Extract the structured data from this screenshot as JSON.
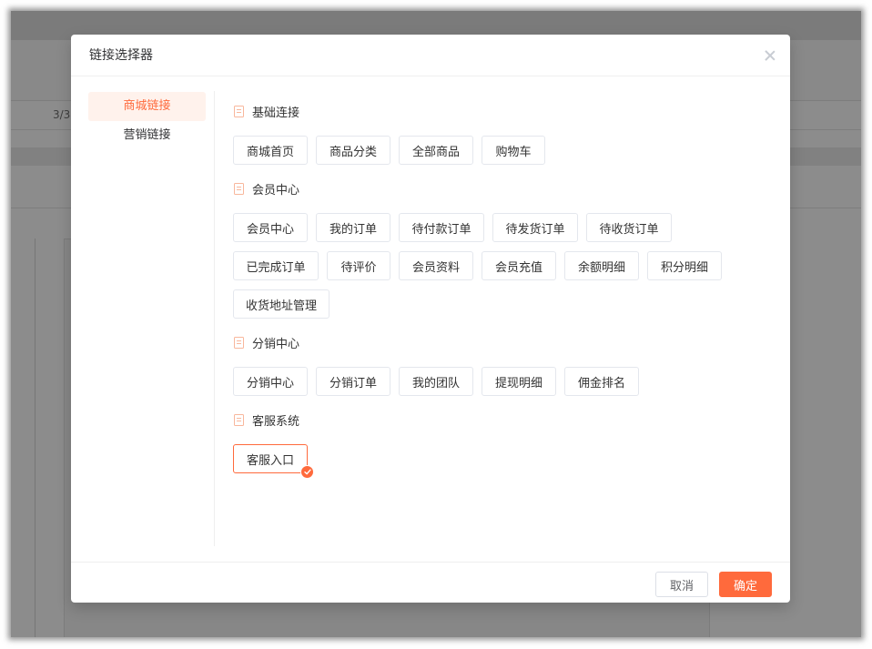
{
  "backdrop": {
    "page_indicator": "3/3"
  },
  "dialog": {
    "title": "链接选择器",
    "close_icon": "close-icon"
  },
  "sidebar": {
    "items": [
      {
        "label": "商城链接",
        "active": true
      },
      {
        "label": "营销链接",
        "active": false
      }
    ]
  },
  "sections": [
    {
      "title": "基础连接",
      "icon": "document-icon",
      "links": [
        {
          "label": "商城首页",
          "selected": false
        },
        {
          "label": "商品分类",
          "selected": false
        },
        {
          "label": "全部商品",
          "selected": false
        },
        {
          "label": "购物车",
          "selected": false
        }
      ]
    },
    {
      "title": "会员中心",
      "icon": "document-icon",
      "links": [
        {
          "label": "会员中心",
          "selected": false
        },
        {
          "label": "我的订单",
          "selected": false
        },
        {
          "label": "待付款订单",
          "selected": false
        },
        {
          "label": "待发货订单",
          "selected": false
        },
        {
          "label": "待收货订单",
          "selected": false
        },
        {
          "label": "已完成订单",
          "selected": false
        },
        {
          "label": "待评价",
          "selected": false
        },
        {
          "label": "会员资料",
          "selected": false
        },
        {
          "label": "会员充值",
          "selected": false
        },
        {
          "label": "余额明细",
          "selected": false
        },
        {
          "label": "积分明细",
          "selected": false
        },
        {
          "label": "收货地址管理",
          "selected": false
        }
      ]
    },
    {
      "title": "分销中心",
      "icon": "document-icon",
      "links": [
        {
          "label": "分销中心",
          "selected": false
        },
        {
          "label": "分销订单",
          "selected": false
        },
        {
          "label": "我的团队",
          "selected": false
        },
        {
          "label": "提现明细",
          "selected": false
        },
        {
          "label": "佣金排名",
          "selected": false
        }
      ]
    },
    {
      "title": "客服系统",
      "icon": "document-icon",
      "links": [
        {
          "label": "客服入口",
          "selected": true
        }
      ]
    }
  ],
  "selected_badge_icon": "check-circle-icon",
  "footer": {
    "cancel_label": "取消",
    "confirm_label": "确定"
  },
  "colors": {
    "accent": "#ff6a3c",
    "accent_light_bg": "#fff2ec",
    "icon_tint": "#f8b79c",
    "overlay": "rgba(0,0,0,0.45)"
  }
}
